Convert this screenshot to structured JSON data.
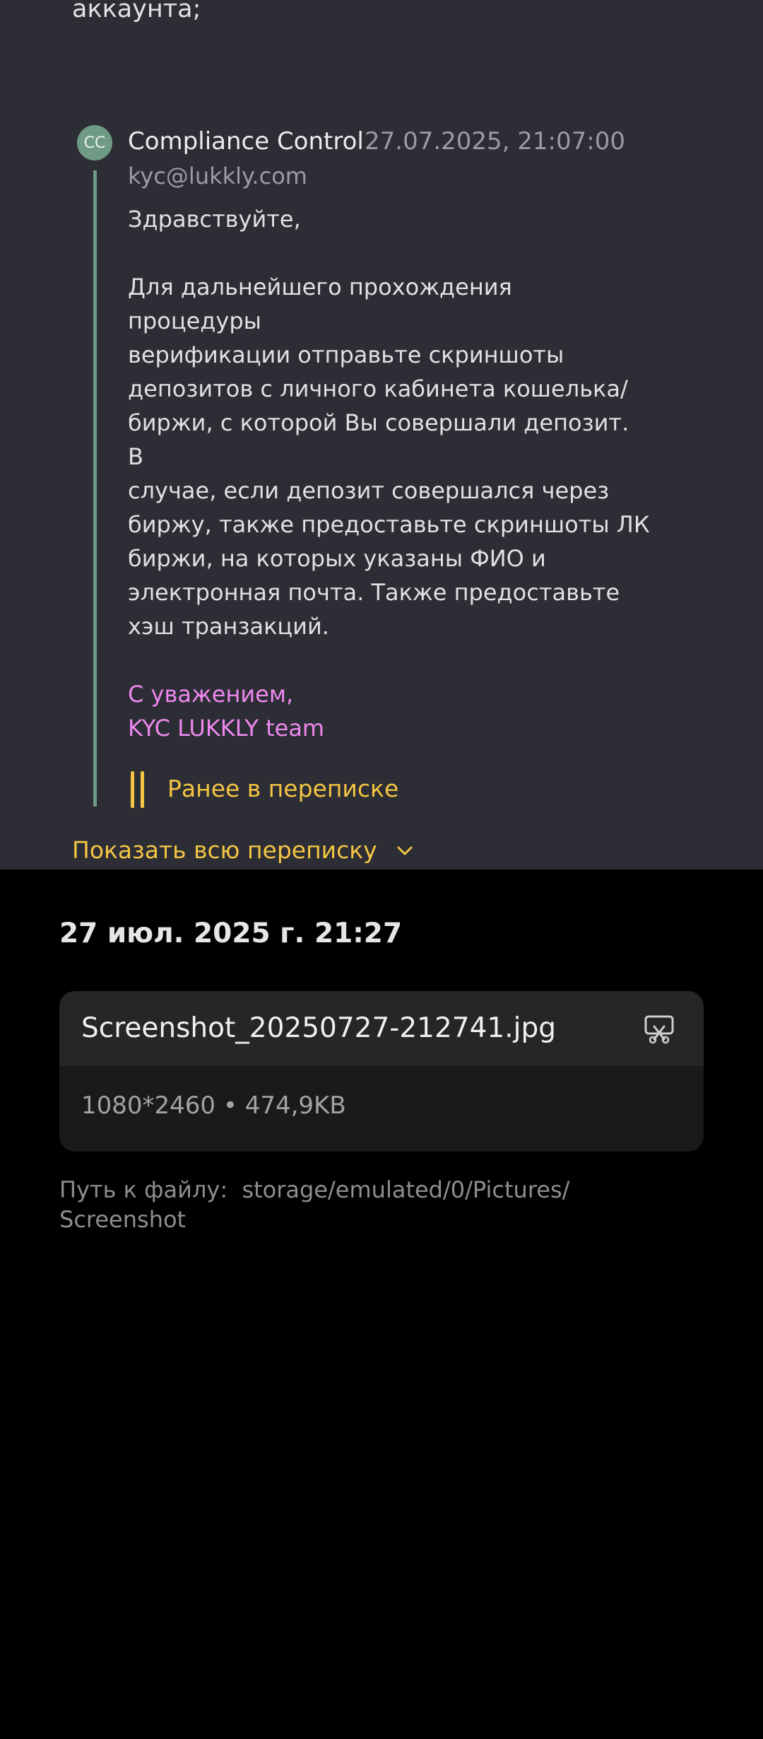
{
  "mail": {
    "previous_line": "аккаунта;",
    "avatar_initials": "CC",
    "sender_name": "Compliance Control",
    "sent_at": "27.07.2025, 21:07:00",
    "sender_email": "kyc@lukkly.com",
    "greeting": "Здравствуйте,",
    "body_lines": [
      "Для дальнейшего прохождения процедуры",
      "верификации отправьте скриншоты",
      "депозитов с личного кабинета кошелька/",
      "биржи, с которой Вы совершали депозит. В",
      "случае, если депозит совершался через",
      "биржу, также предоставьте скриншоты ЛК",
      "биржи, на которых указаны ФИО и",
      "электронная почта. Также предоставьте",
      "хэш транзакций."
    ],
    "signature_lines": [
      "С уважением,",
      "KYC LUKKLY team"
    ],
    "earlier_label": "Ранее в переписке",
    "show_all_label": "Показать всю переписку"
  },
  "image_info": {
    "date": "27 июл. 2025 г.  21:27",
    "file_name": "Screenshot_20250727-212741.jpg",
    "file_meta": "1080*2460 • 474,9KB",
    "path_label": "Путь к файлу:",
    "path_value": "storage/emulated/0/Pictures/ Screenshot"
  },
  "colors": {
    "mail_background": "#2c2d35",
    "accent_yellow": "#f5c543",
    "signature_pink": "#ee88ee",
    "thread_green": "#6f9a86",
    "info_background": "#000000"
  },
  "icons": {
    "show_all": "chevron-down-icon",
    "edit": "edit-image-icon"
  }
}
